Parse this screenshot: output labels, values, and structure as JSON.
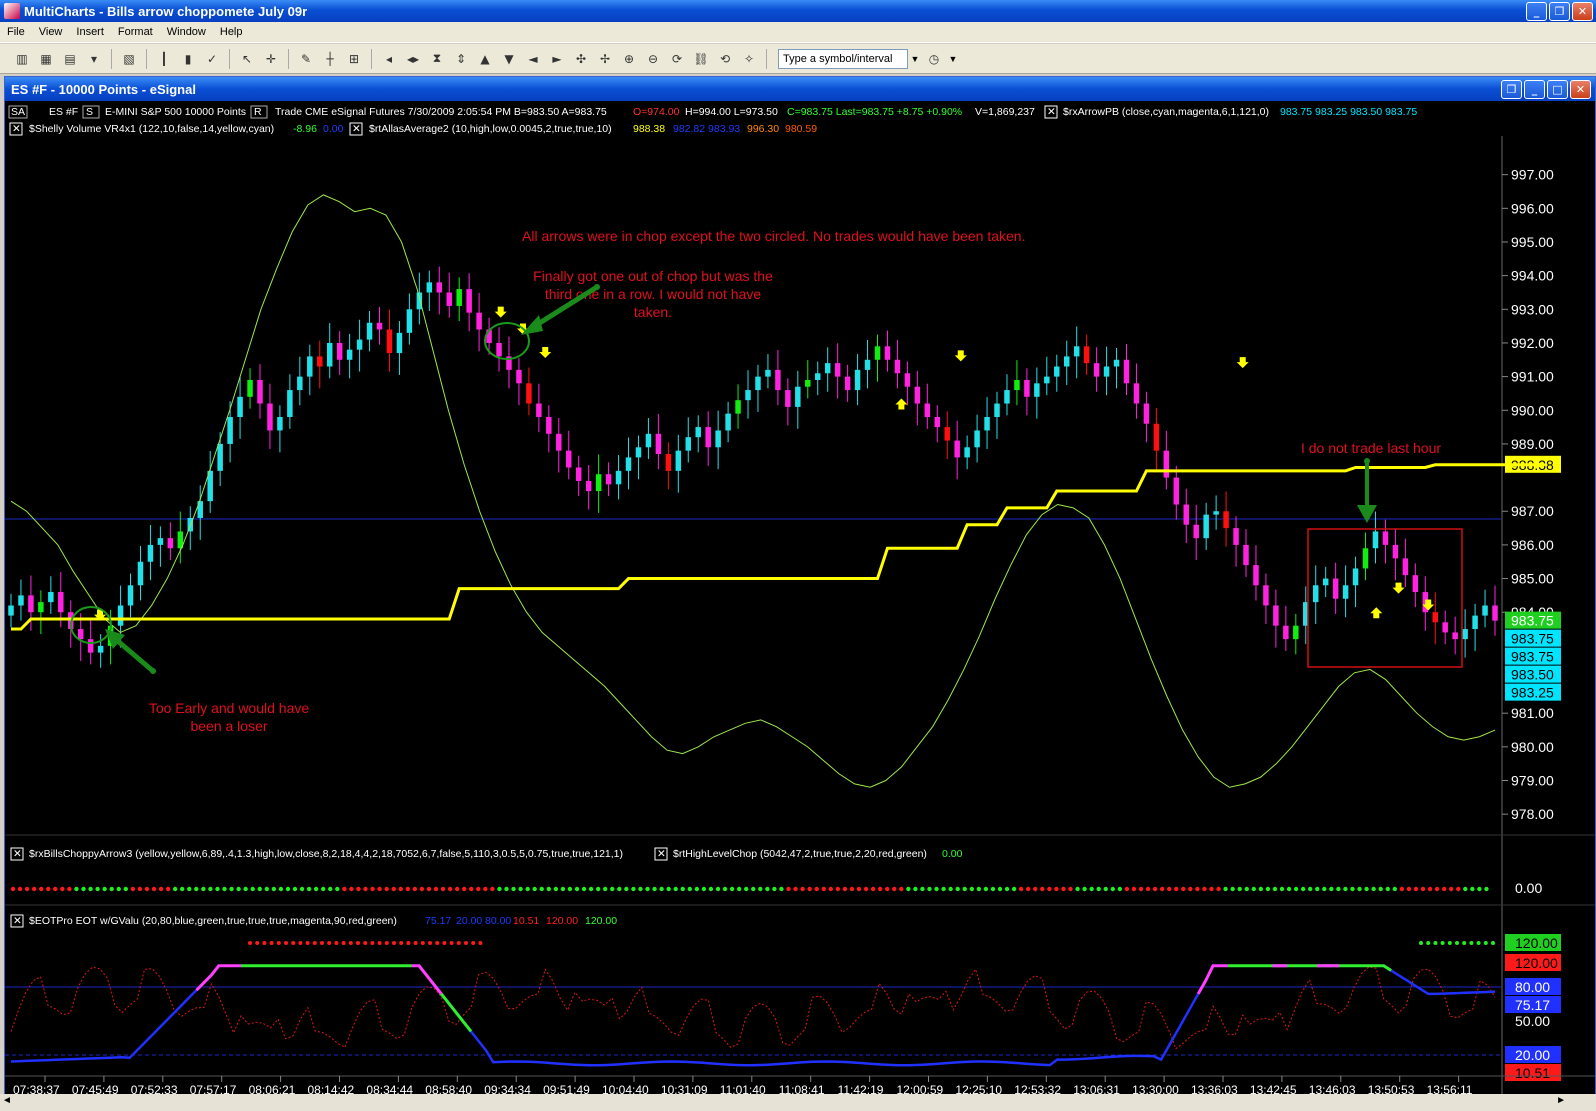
{
  "app": {
    "title": "MultiCharts - Bills arrow choppomete July 09r",
    "menu": [
      "File",
      "View",
      "Insert",
      "Format",
      "Window",
      "Help"
    ],
    "symbol_placeholder": "Type a symbol/interval"
  },
  "chart_window": {
    "title": "ES #F - 10000 Points - eSignal",
    "header_line": {
      "sa": "SA",
      "symbol": "ES #F",
      "s_btn": "S",
      "desc": "E-MINI S&P 500  10000 Points",
      "r_btn": "R",
      "info": "Trade  CME  eSignal  Futures  7/30/2009  2:05:54 PM  B=983.50  A=983.75",
      "open": "O=974.00",
      "hl": "H=994.00  L=973.50",
      "close": "C=983.75  Last=983.75  +8.75  +0.90%",
      "vol": "V=1,869,237",
      "study1_name": "$rxArrowPB  (close,cyan,magenta,6,1,121,0)",
      "study1_vals": "983.75  983.25  983.50  983.75"
    },
    "study_line2": {
      "s1_name": "$Shelly Volume VR4x1  (122,10,false,14,yellow,cyan)",
      "s1_v1": "-8.96",
      "s1_v2": "0.00",
      "s2_name": "$rtAllasAverage2  (10,high,low,0.0045,2,true,true,10)",
      "s2_v1": "988.38",
      "s2_v2": "982.82  983.93",
      "s2_v3": "996.30",
      "s2_v4": "980.59"
    },
    "sub1": {
      "name": "$rxBillsChoppyArrow3  (yellow,yellow,6,89,.4,1.3,high,low,close,8,2,18,4,4,2,18,7052,6,7,false,5,110,3,0.5,5,0.75,true,true,121,1)",
      "name2": "$rtHighLevelChop  (5042,47,2,true,true,2,20,red,green)",
      "val2": "0.00",
      "axis": "0.00"
    },
    "sub2": {
      "name": "$EOTPro EOT w/GValu  (20,80,blue,green,true,true,true,magenta,90,red,green)",
      "v1": "75.17",
      "v2": "20.00",
      "v3": "80.00",
      "v4": "10.51",
      "v5": "120.00",
      "v6": "120.00",
      "axis_labels": [
        "120.00",
        "120.00",
        "80.00",
        "75.17",
        "50.00",
        "20.00",
        "10.51"
      ]
    },
    "price_axis": [
      "997.00",
      "996.00",
      "995.00",
      "994.00",
      "993.00",
      "992.00",
      "991.00",
      "990.00",
      "989.00",
      "988.38",
      "987.00",
      "986.00",
      "985.00",
      "984.00",
      "983.75",
      "983.75",
      "983.75",
      "983.50",
      "983.25",
      "981.00",
      "980.00",
      "979.00",
      "978.00"
    ],
    "time_axis": [
      "07:38:37",
      "07:45:49",
      "07:52:33",
      "07:57:17",
      "08:06:21",
      "08:14:42",
      "08:34:44",
      "08:58:40",
      "09:34:34",
      "09:51:49",
      "10:04:40",
      "10:31:09",
      "11:01:40",
      "11:08:41",
      "11:42:19",
      "12:00:59",
      "12:25:10",
      "12:53:32",
      "13:06:31",
      "13:30:00",
      "13:36:03",
      "13:42:45",
      "13:46:03",
      "13:50:53",
      "13:56:11"
    ],
    "annotations": {
      "a1": "All arrows were in chop except the two circled.  No trades would have been taken.",
      "a2_l1": "Finally got one out of chop but was the",
      "a2_l2": "third one in a row.  I would not have",
      "a2_l3": "taken.",
      "a3": "I do not trade last hour",
      "a4_l1": "Too Early and would have",
      "a4_l2": "been a loser"
    }
  },
  "chart_data": {
    "type": "candlestick",
    "y_range": [
      977.5,
      998.0
    ],
    "closes": [
      984.2,
      984.5,
      984.0,
      984.3,
      984.6,
      984.0,
      983.5,
      983.2,
      982.8,
      983.0,
      983.6,
      984.2,
      984.8,
      985.5,
      986.0,
      986.2,
      985.9,
      986.4,
      986.8,
      987.3,
      988.2,
      989.0,
      989.8,
      990.4,
      990.9,
      990.2,
      989.4,
      989.8,
      990.6,
      991.0,
      991.6,
      991.3,
      992.0,
      991.5,
      991.8,
      992.1,
      992.6,
      992.4,
      991.7,
      992.3,
      993.0,
      993.5,
      993.8,
      993.5,
      993.1,
      993.6,
      992.9,
      992.4,
      992.0,
      991.6,
      991.2,
      990.8,
      990.2,
      989.8,
      989.3,
      988.8,
      988.3,
      987.9,
      987.6,
      988.1,
      987.8,
      988.2,
      988.6,
      988.9,
      989.3,
      988.7,
      988.2,
      988.8,
      989.2,
      989.5,
      988.9,
      989.4,
      989.9,
      990.3,
      990.6,
      991.0,
      991.2,
      990.6,
      990.1,
      990.7,
      990.9,
      991.1,
      991.4,
      991.0,
      990.6,
      991.2,
      991.5,
      991.9,
      991.5,
      991.1,
      990.7,
      990.2,
      989.8,
      989.5,
      989.1,
      988.6,
      988.9,
      989.4,
      989.8,
      990.2,
      990.6,
      990.9,
      990.4,
      990.8,
      991.0,
      991.3,
      991.6,
      991.9,
      991.4,
      991.0,
      991.3,
      991.5,
      990.8,
      990.2,
      989.6,
      988.8,
      988.0,
      987.2,
      986.6,
      986.2,
      986.9,
      987.0,
      986.5,
      986.0,
      985.4,
      984.8,
      984.2,
      983.6,
      983.2,
      983.6,
      984.3,
      984.8,
      985.0,
      984.4,
      984.8,
      985.3,
      985.9,
      986.4,
      986.0,
      985.6,
      985.1,
      984.6,
      984.0,
      983.7,
      983.4,
      983.2,
      983.5,
      983.9,
      984.2,
      983.75
    ],
    "series": [
      {
        "name": "$rtAllasAverage2",
        "values": [
          983.5,
          983.5,
          983.8,
          983.8,
          983.8,
          983.8,
          983.8,
          983.8,
          983.8,
          983.8,
          983.8,
          983.8,
          983.8,
          983.8,
          983.8,
          983.8,
          983.8,
          983.8,
          983.8,
          983.8,
          983.8,
          983.8,
          983.8,
          983.8,
          983.8,
          983.8,
          983.8,
          983.8,
          983.8,
          983.8,
          983.8,
          983.8,
          983.8,
          983.8,
          983.8,
          983.8,
          983.8,
          983.8,
          983.8,
          983.8,
          983.8,
          983.8,
          983.8,
          983.8,
          983.8,
          984.7,
          984.7,
          984.7,
          984.7,
          984.7,
          984.7,
          984.7,
          984.7,
          984.7,
          984.7,
          984.7,
          984.7,
          984.7,
          984.7,
          984.7,
          984.7,
          984.7,
          985.0,
          985.0,
          985.0,
          985.0,
          985.0,
          985.0,
          985.0,
          985.0,
          985.0,
          985.0,
          985.0,
          985.0,
          985.0,
          985.0,
          985.0,
          985.0,
          985.0,
          985.0,
          985.0,
          985.0,
          985.0,
          985.0,
          985.0,
          985.0,
          985.0,
          985.0,
          985.9,
          985.9,
          985.9,
          985.9,
          985.9,
          985.9,
          985.9,
          985.9,
          986.6,
          986.6,
          986.6,
          986.6,
          987.1,
          987.1,
          987.1,
          987.1,
          987.1,
          987.6,
          987.6,
          987.6,
          987.6,
          987.6,
          987.6,
          987.6,
          987.6,
          987.6,
          988.2,
          988.2,
          988.2,
          988.2,
          988.2,
          988.2,
          988.2,
          988.2,
          988.2,
          988.2,
          988.2,
          988.2,
          988.2,
          988.2,
          988.2,
          988.2,
          988.2,
          988.2,
          988.2,
          988.2,
          988.2,
          988.3,
          988.3,
          988.3,
          988.3,
          988.3,
          988.3,
          988.3,
          988.3,
          988.38,
          988.38,
          988.38,
          988.38,
          988.38,
          988.38,
          988.38,
          988.38,
          988.38,
          988.38,
          988.38,
          988.38
        ]
      },
      {
        "name": "$Shelly Volume VR4x1",
        "values": [
          987.3,
          987.0,
          986.5,
          986.0,
          985.2,
          984.5,
          983.8,
          983.4,
          983.6,
          984.2,
          985.0,
          986.0,
          987.2,
          988.6,
          990.0,
          991.5,
          993.0,
          994.2,
          995.3,
          996.1,
          996.4,
          996.2,
          995.9,
          996.0,
          995.8,
          995.0,
          993.6,
          991.8,
          990.0,
          988.4,
          987.0,
          985.8,
          984.8,
          984.0,
          983.4,
          983.0,
          982.6,
          982.2,
          981.8,
          981.3,
          980.8,
          980.3,
          979.9,
          979.8,
          980.0,
          980.3,
          980.5,
          980.7,
          980.8,
          980.6,
          980.3,
          980.0,
          979.6,
          979.2,
          978.9,
          978.8,
          979.0,
          979.4,
          980.0,
          980.6,
          981.4,
          982.3,
          983.3,
          984.4,
          985.4,
          986.3,
          986.9,
          987.2,
          987.1,
          986.8,
          986.0,
          985.0,
          983.8,
          982.6,
          981.5,
          980.5,
          979.7,
          979.1,
          978.8,
          978.9,
          979.1,
          979.5,
          980.0,
          980.6,
          981.2,
          981.8,
          982.2,
          982.3,
          982.0,
          981.5,
          981.0,
          980.6,
          980.3,
          980.2,
          980.3,
          980.5
        ]
      }
    ]
  }
}
